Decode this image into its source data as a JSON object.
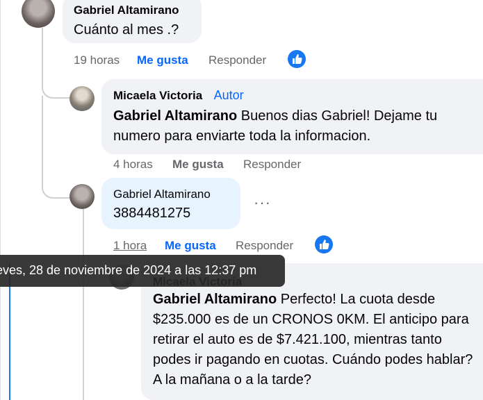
{
  "comments": [
    {
      "author": "Gabriel Altamirano",
      "text": "Cuánto al mes .?",
      "time": "19 horas",
      "like_label": "Me gusta",
      "reply_label": "Responder"
    },
    {
      "author": "Micaela Victoria",
      "author_badge": "Autor",
      "mention": "Gabriel Altamirano",
      "text": " Buenos dias Gabriel! Dejame tu numero para enviarte toda la informacion.",
      "time": "4 horas",
      "like_label": "Me gusta",
      "reply_label": "Responder"
    },
    {
      "author": "Gabriel Altamirano",
      "text": "3884481275",
      "time": "1 hora",
      "like_label": "Me gusta",
      "reply_label": "Responder"
    },
    {
      "author": "Micaela Victoria",
      "mention": "Gabriel Altamirano",
      "text": " Perfecto! La cuota desde $235.000 es de un CRONOS 0KM. El anticipo para retirar el auto es de $7.421.100, mientras tanto podes ir pagando en cuotas. Cuándo podes hablar? A la mañana o a la tarde?"
    }
  ],
  "tooltip": "eves, 28 de noviembre de 2024 a las 12:37 pm",
  "more_options": "···",
  "colors": {
    "link": "#0866ff",
    "like_badge": "#1877f2",
    "bubble": "#f0f2f5",
    "bubble_highlight": "#e7f3ff"
  }
}
